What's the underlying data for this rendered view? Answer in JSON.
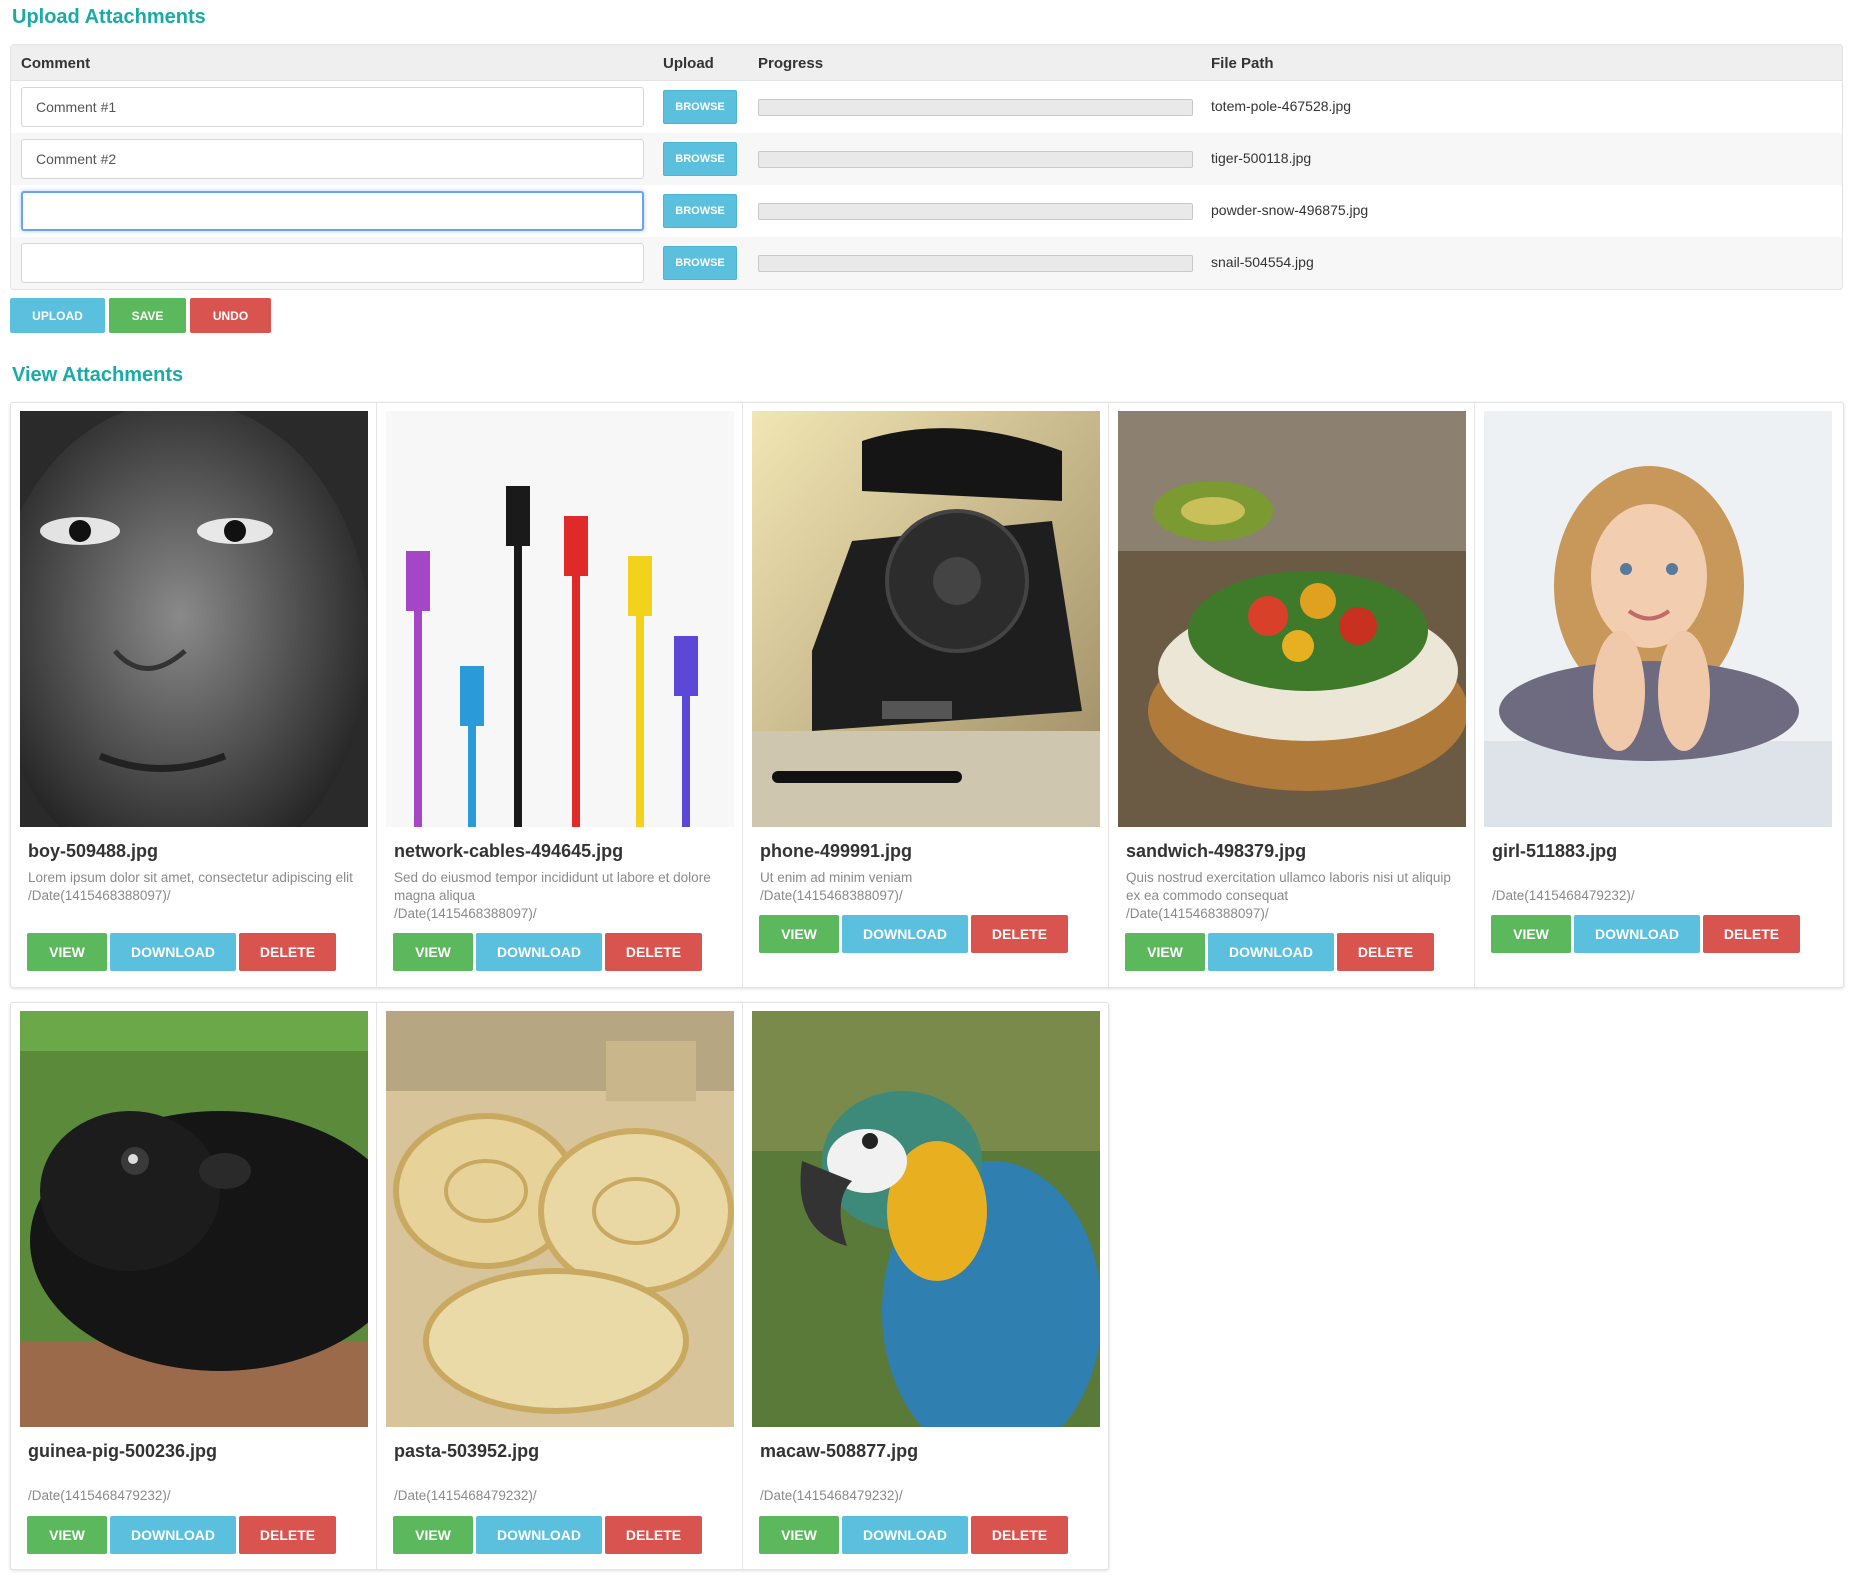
{
  "upload_section": {
    "title": "Upload Attachments",
    "headers": {
      "comment": "Comment",
      "upload": "Upload",
      "progress": "Progress",
      "file_path": "File Path"
    },
    "rows": [
      {
        "comment": "Comment #1",
        "browse": "BROWSE",
        "progress": 0,
        "file_path": "totem-pole-467528.jpg"
      },
      {
        "comment": "Comment #2",
        "browse": "BROWSE",
        "progress": 0,
        "file_path": "tiger-500118.jpg"
      },
      {
        "comment": "",
        "browse": "BROWSE",
        "progress": 0,
        "file_path": "powder-snow-496875.jpg"
      },
      {
        "comment": "",
        "browse": "BROWSE",
        "progress": 0,
        "file_path": "snail-504554.jpg"
      }
    ],
    "actions": {
      "upload": "UPLOAD",
      "save": "SAVE",
      "undo": "UNDO"
    }
  },
  "view_section": {
    "title": "View Attachments",
    "items": [
      {
        "name": "boy-509488.jpg",
        "description": "Lorem ipsum dolor sit amet, consectetur adipiscing elit",
        "path": "/Date(1415468388097)/",
        "image": "boy-image"
      },
      {
        "name": "network-cables-494645.jpg",
        "description": "Sed do eiusmod tempor incididunt ut labore et dolore magna aliqua",
        "path": "/Date(1415468388097)/",
        "image": "network-cables-image"
      },
      {
        "name": "phone-499991.jpg",
        "description": "Ut enim ad minim veniam",
        "path": "/Date(1415468388097)/",
        "image": "phone-image"
      },
      {
        "name": "sandwich-498379.jpg",
        "description": "Quis nostrud exercitation ullamco laboris nisi ut aliquip ex ea commodo consequat",
        "path": "/Date(1415468388097)/",
        "image": "sandwich-image"
      },
      {
        "name": "girl-511883.jpg",
        "description": "",
        "path": "/Date(1415468479232)/",
        "image": "girl-image"
      },
      {
        "name": "guinea-pig-500236.jpg",
        "description": "",
        "path": "/Date(1415468479232)/",
        "image": "guinea-pig-image"
      },
      {
        "name": "pasta-503952.jpg",
        "description": "",
        "path": "/Date(1415468479232)/",
        "image": "pasta-image"
      },
      {
        "name": "macaw-508877.jpg",
        "description": "",
        "path": "/Date(1415468479232)/",
        "image": "macaw-image"
      }
    ],
    "buttons": {
      "view": "VIEW",
      "download": "DOWNLOAD",
      "delete": "DELETE"
    }
  },
  "colors": {
    "accent": "#1aaba6",
    "info": "#5bc0de",
    "success": "#5cb85c",
    "danger": "#d9534f"
  }
}
